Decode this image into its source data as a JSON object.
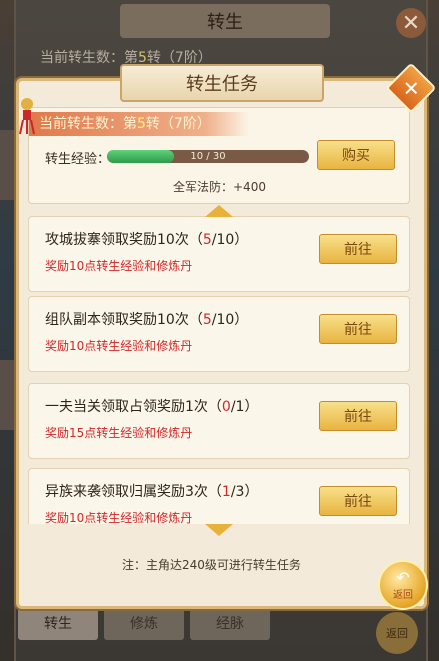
{
  "background": {
    "title": "转生",
    "count_prefix": "当前转生数：第",
    "count_value": "5",
    "count_suffix": "转（7阶）",
    "tabs": [
      "转生",
      "修炼",
      "经脉"
    ],
    "return_label": "返回"
  },
  "dialog": {
    "title": "转生任务",
    "banner_prefix": "当前转生数：第",
    "banner_value": "5",
    "banner_suffix": "转（7阶）",
    "exp_label": "转生经验：",
    "exp_current": 10,
    "exp_max": 30,
    "exp_text": "10 / 30",
    "buy_label": "购买",
    "bonus": "全军法防：+400",
    "note": "注：主角达240级可进行转生任务",
    "return_label": "返回"
  },
  "tasks": [
    {
      "title": "攻城拔寨领取奖励10次",
      "progress_open": "（",
      "current": "5",
      "total": "/10）",
      "reward": "奖励10点转生经验和修炼丹",
      "button": "前往"
    },
    {
      "title": "组队副本领取奖励10次",
      "progress_open": "（",
      "current": "5",
      "total": "/10）",
      "reward": "奖励10点转生经验和修炼丹",
      "button": "前往"
    },
    {
      "title": "一夫当关领取占领奖励1次",
      "progress_open": "（",
      "current": "0",
      "total": "/1）",
      "reward": "奖励15点转生经验和修炼丹",
      "button": "前往"
    },
    {
      "title": "异族来袭领取归属奖励3次",
      "progress_open": "（",
      "current": "1",
      "total": "/3）",
      "reward": "奖励10点转生经验和修炼丹",
      "button": "前往"
    }
  ],
  "colors": {
    "accent_red": "#d2282a",
    "button_gold": "#e8b440",
    "progress_green": "#2e9a4a"
  }
}
